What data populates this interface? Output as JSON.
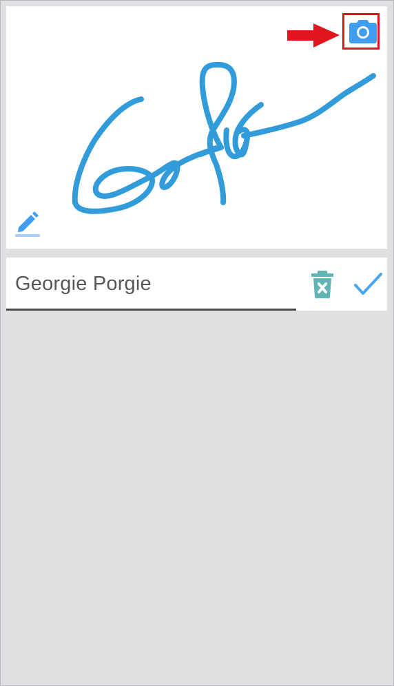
{
  "signature_panel": {
    "camera_icon": "camera-icon",
    "pen_icon": "pen-icon",
    "arrow_icon": "arrow-right-icon"
  },
  "name_row": {
    "name_value": "Georgie Porgie",
    "delete_icon": "trash-x-icon",
    "confirm_icon": "check-icon"
  },
  "colors": {
    "signature_stroke": "#329bd9",
    "camera": "#3f9ef1",
    "highlight": "#e0161f",
    "trash": "#5fb6b3",
    "check": "#4aa6f0",
    "background": "#e2dfe3"
  }
}
